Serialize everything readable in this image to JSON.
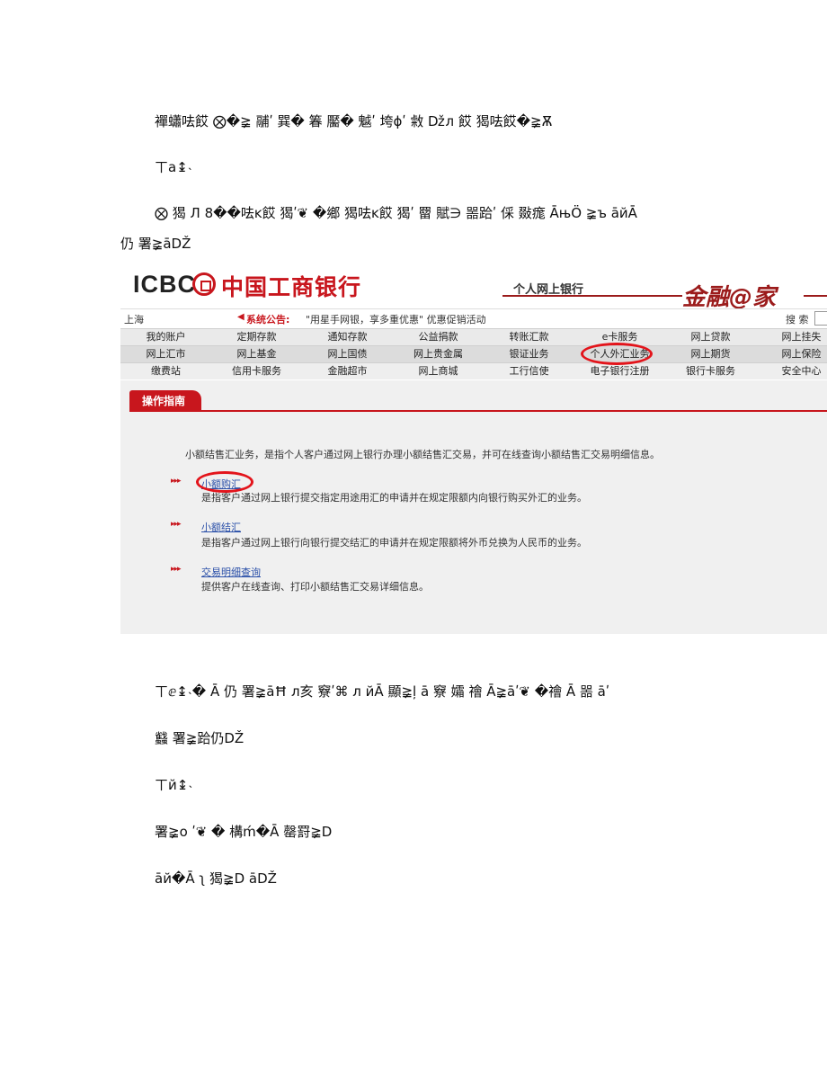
{
  "doc_lines": [
    "襌蠨呿餀 ⨂�≩ 鬴ʹ 巽� 箺 靨� 魆ʹ 垮ɸʹ 敹 ǅл 餀 猲呿餀�≩Ѫ",
    "ㄒa↨˴",
    "⨂ 猲 Л 8��呿ĸ餀 猲ʹ❦ �鄉 猲呿ĸ餀 猲ʹ 罶 賦∋ 噐跲ʹ 倸 敠痝 ĀњÖ ≩ъ āйĀ",
    "仍 署≩āDŽ",
    "ㄒⅇ↨˴� Ā 仍 署≩āĦ л亥 竂ʹ⌘ л йĀ 顯≩ļ ā 竂 孀 禬 Ā≩āʹ❦ �禬 Ā 噐 āʹ",
    "蠽 署≩跲仍DŽ",
    "ㄒй↨˴",
    "署≩o ʹ❦ � 構ḿ�Ā 罄罸≩D",
    "āй�Ā ʅ 猲≩D āDŽ"
  ],
  "screenshot": {
    "brand_latin": "ICBC",
    "brand_cn": "中国工商银行",
    "tagline": "个人网上银行",
    "jinrong": "金融@家",
    "region": "上海",
    "notice_label": "系统公告:",
    "notice_text": "\"用星手网银，享多重优惠\" 优惠促销活动",
    "search_label": "搜  索",
    "menu_row1": [
      "我的账户",
      "定期存款",
      "通知存款",
      "公益捐款",
      "转账汇款",
      "e卡服务",
      "网上贷款",
      "网上挂失"
    ],
    "menu_row2": [
      "网上汇市",
      "网上基金",
      "网上国债",
      "网上贵金属",
      "银证业务",
      "个人外汇业务",
      "网上期货",
      "网上保险"
    ],
    "menu_row3": [
      "缴费站",
      "信用卡服务",
      "金融超市",
      "网上商城",
      "工行信使",
      "电子银行注册",
      "银行卡服务",
      "安全中心"
    ],
    "guide_title": "操作指南",
    "intro": "小额结售汇业务，是指个人客户通过网上银行办理小额结售汇交易，并可在线查询小额结售汇交易明细信息。",
    "items": [
      {
        "link": "小额购汇",
        "desc": "是指客户通过网上银行提交指定用途用汇的申请并在规定限额内向银行购买外汇的业务。"
      },
      {
        "link": "小额结汇",
        "desc": "是指客户通过网上银行向银行提交结汇的申请并在规定限额将外币兑换为人民币的业务。"
      },
      {
        "link": "交易明细查询",
        "desc": "提供客户在线查询、打印小额结售汇交易详细信息。"
      }
    ],
    "arrow_glyph": "▸▸▸",
    "speaker_glyph": "◀"
  }
}
